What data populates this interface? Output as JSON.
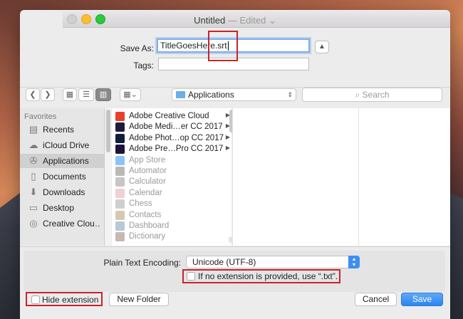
{
  "window": {
    "title": "Untitled",
    "edited": "— Edited",
    "edited_chevron": "⌄"
  },
  "save_as": {
    "label": "Save As:",
    "value": "TitleGoesHere.srt"
  },
  "tags": {
    "label": "Tags:",
    "value": ""
  },
  "toolbar": {
    "location": "Applications",
    "search_placeholder": "Search"
  },
  "sidebar": {
    "heading": "Favorites",
    "items": [
      {
        "label": "Recents",
        "icon": "clock-icon"
      },
      {
        "label": "iCloud Drive",
        "icon": "cloud-icon"
      },
      {
        "label": "Applications",
        "icon": "applications-icon",
        "selected": true
      },
      {
        "label": "Documents",
        "icon": "documents-icon"
      },
      {
        "label": "Downloads",
        "icon": "downloads-icon"
      },
      {
        "label": "Desktop",
        "icon": "desktop-icon"
      },
      {
        "label": "Creative Clou…",
        "icon": "creative-cloud-icon"
      }
    ]
  },
  "files": [
    {
      "name": "Adobe Creative Cloud",
      "color": "#e8402a",
      "folder": true,
      "dim": false
    },
    {
      "name": "Adobe Medi…er CC 2017",
      "color": "#1e1a3a",
      "folder": true,
      "dim": false
    },
    {
      "name": "Adobe Phot…op CC 2017",
      "color": "#0f1e3c",
      "folder": true,
      "dim": false
    },
    {
      "name": "Adobe Pre…Pro CC 2017",
      "color": "#1e1238",
      "folder": true,
      "dim": false
    },
    {
      "name": "App Store",
      "color": "#8cc3f5",
      "folder": false,
      "dim": true
    },
    {
      "name": "Automator",
      "color": "#b9b9b9",
      "folder": false,
      "dim": true
    },
    {
      "name": "Calculator",
      "color": "#c6c6c6",
      "folder": false,
      "dim": true
    },
    {
      "name": "Calendar",
      "color": "#f0d0d0",
      "folder": false,
      "dim": true
    },
    {
      "name": "Chess",
      "color": "#cfcfcf",
      "folder": false,
      "dim": true
    },
    {
      "name": "Contacts",
      "color": "#d8c8b0",
      "folder": false,
      "dim": true
    },
    {
      "name": "Dashboard",
      "color": "#b8c8d8",
      "folder": false,
      "dim": true
    },
    {
      "name": "Dictionary",
      "color": "#c8b8b0",
      "folder": false,
      "dim": true
    }
  ],
  "options": {
    "encoding_label": "Plain Text Encoding:",
    "encoding_value": "Unicode (UTF-8)",
    "extension_checkbox": "If no extension is provided, use “.txt”."
  },
  "footer": {
    "hide_extension": "Hide extension",
    "new_folder": "New Folder",
    "cancel": "Cancel",
    "save": "Save"
  },
  "colors": {
    "accent": "#3d8ef0",
    "highlight": "#c8232c"
  }
}
